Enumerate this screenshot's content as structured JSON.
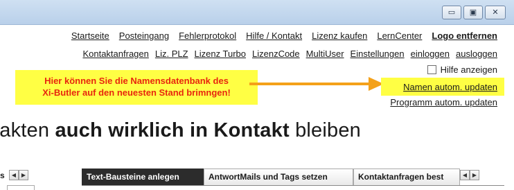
{
  "window": {
    "minimize_glyph": "▭",
    "maximize_glyph": "▣",
    "close_glyph": "✕"
  },
  "nav_row1": [
    "Startseite",
    "Posteingang",
    "Fehlerprotokol",
    "Hilfe / Kontakt",
    "Lizenz kaufen",
    "LernCenter",
    "Logo entfernen"
  ],
  "nav_row2": [
    "Kontaktanfragen",
    "Liz. PLZ",
    "Lizenz Turbo",
    "LizenzCode",
    "MultiUser",
    "Einstellungen",
    "einloggen",
    "ausloggen"
  ],
  "help": {
    "label": "Hilfe anzeigen",
    "checked": false
  },
  "callout": {
    "line1": "Hier können Sie die Namensdatenbank des",
    "line2": "Xi-Butler auf den neuesten Stand brimngen!"
  },
  "updates": {
    "names": "Namen autom. updaten",
    "program": "Programm autom. updaten"
  },
  "headline": {
    "part1": "takten ",
    "bold": "auch wirklich in Kontakt",
    "part2": " bleiben"
  },
  "left_fragment": "s",
  "tabs": [
    {
      "label": "Text-Bausteine anlegen",
      "active": true
    },
    {
      "label": "AntwortMails und Tags setzen",
      "active": false
    },
    {
      "label": "Kontaktanfragen best",
      "active": false
    }
  ],
  "scroll_glyphs": {
    "left": "◀",
    "right": "▶"
  },
  "colors": {
    "callout_bg": "#ffff44",
    "callout_text": "#e8260e",
    "arrow": "#f4a11a",
    "active_tab": "#2c2c2c"
  }
}
